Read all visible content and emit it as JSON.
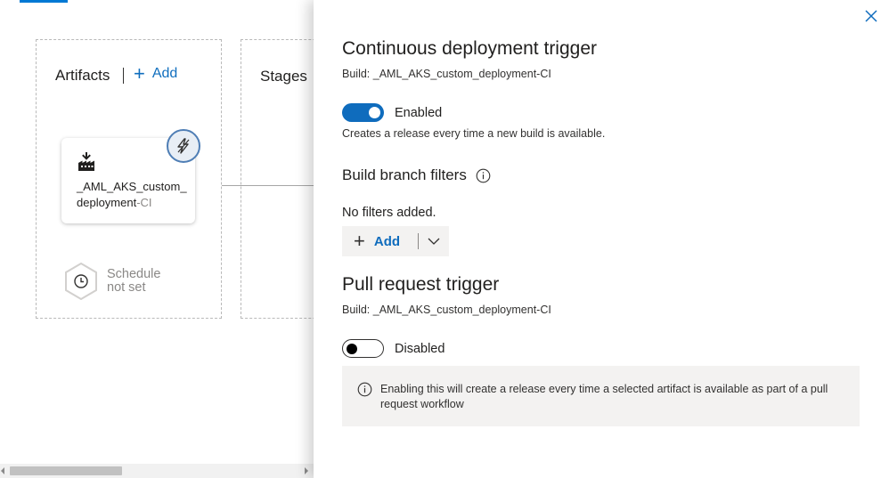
{
  "canvas": {
    "artifacts_title": "Artifacts",
    "add_label": "Add",
    "stages_title": "Stages",
    "artifact": {
      "name": "_AML_AKS_custom_deployment",
      "suffix": "-CI",
      "icon": "build-factory-icon"
    },
    "trigger_icon": "lightning-bolt-icon",
    "schedule_label": "Schedule not set",
    "schedule_icon": "clock-icon"
  },
  "panel": {
    "close_icon": "close-icon",
    "cd_trigger": {
      "title": "Continuous deployment trigger",
      "build": "Build: _AML_AKS_custom_deployment-CI",
      "toggle_label": "Enabled",
      "toggle_on": true,
      "description": "Creates a release every time a new build is available."
    },
    "branch_filters": {
      "title": "Build branch filters",
      "empty_text": "No filters added.",
      "add_label": "Add"
    },
    "pr_trigger": {
      "title": "Pull request trigger",
      "build": "Build: _AML_AKS_custom_deployment-CI",
      "toggle_label": "Disabled",
      "toggle_on": false,
      "info": "Enabling this will create a release every time a selected artifact is available as part of a pull request workflow"
    }
  },
  "colors": {
    "accent": "#0f6cbd",
    "link": "#106ebe",
    "info_bg": "#f3f2f1"
  }
}
